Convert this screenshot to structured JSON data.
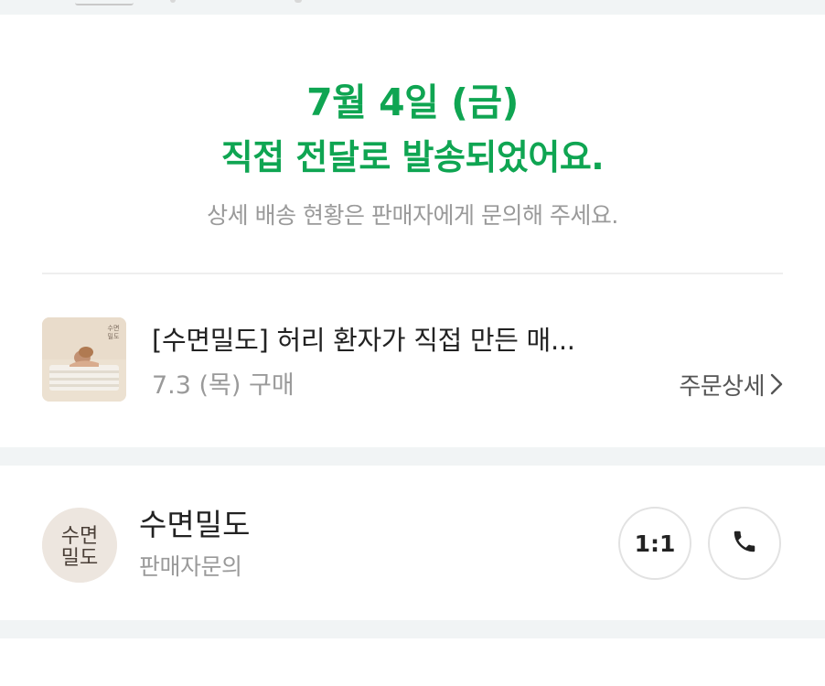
{
  "status": {
    "date_line": "7월 4일 (금)",
    "main_line": "직접 전달로 발송되었어요.",
    "sub_line": "상세 배송 현황은 판매자에게 문의해 주세요."
  },
  "product": {
    "title": "[수면밀도] 허리 환자가 직접 만든 매...",
    "purchase_date": "7.3 (목) 구매",
    "order_detail_label": "주문상세",
    "thumbnail_brand": "수면 밀도"
  },
  "seller": {
    "name": "수면밀도",
    "sub_label": "판매자문의",
    "avatar_text_top": "수면",
    "avatar_text_bottom": "밀도",
    "chat_button_label": "1:1",
    "call_icon": "phone-icon"
  },
  "colors": {
    "accent_green": "#0fa552",
    "section_gap": "#f1f4f5",
    "muted_text": "#9a9a9a"
  }
}
